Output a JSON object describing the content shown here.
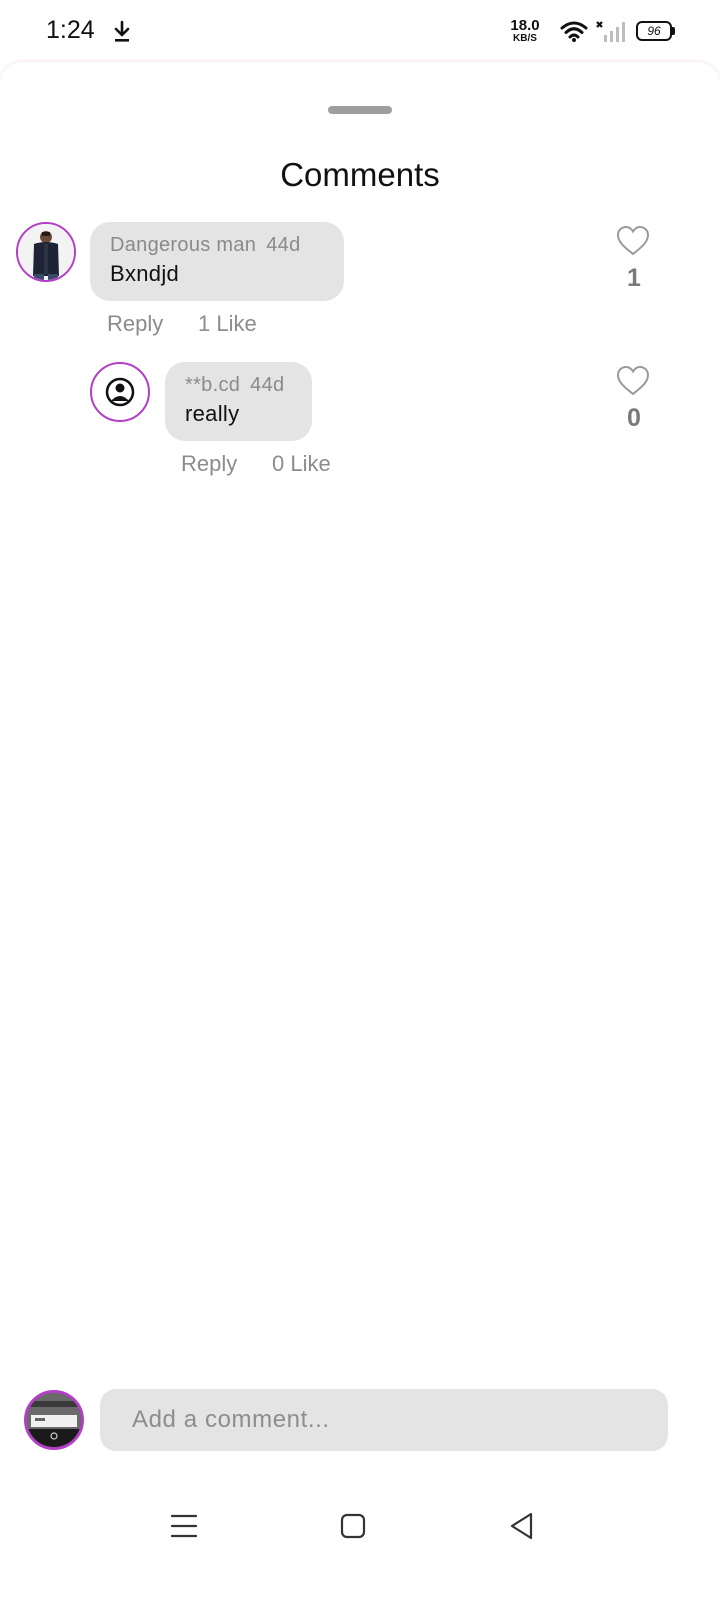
{
  "status_bar": {
    "time": "1:24",
    "net_speed": "18.0",
    "net_unit": "KB/S",
    "battery": "96",
    "icons": [
      "download-icon",
      "wifi-icon",
      "signal-icon",
      "battery-icon"
    ]
  },
  "sheet": {
    "title": "Comments"
  },
  "comments": [
    {
      "author": "Dangerous man",
      "time": "44d",
      "text": "Bxndjd",
      "reply_label": "Reply",
      "likes_label": "1 Like",
      "like_count": "1"
    },
    {
      "author": "**b.cd",
      "time": "44d",
      "text": "really",
      "reply_label": "Reply",
      "likes_label": "0 Like",
      "like_count": "0"
    }
  ],
  "composer": {
    "placeholder": "Add a comment..."
  },
  "nav_bar": {
    "buttons": [
      "menu-icon",
      "home-icon",
      "back-icon"
    ]
  },
  "colors": {
    "accent": "#b23fc6",
    "bubble": "#e4e4e4",
    "muted_text": "#8c8c8c"
  }
}
